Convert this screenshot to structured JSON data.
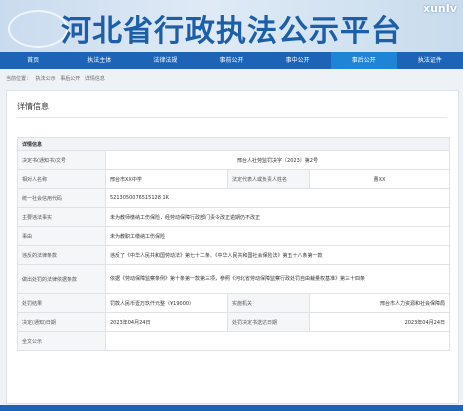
{
  "site": {
    "title": "河北省行政执法公示平台",
    "watermark": "xunIv"
  },
  "nav": [
    {
      "label": "首页"
    },
    {
      "label": "执法主体"
    },
    {
      "label": "法律法规"
    },
    {
      "label": "事前公开"
    },
    {
      "label": "事中公开"
    },
    {
      "label": "事后公开"
    },
    {
      "label": "执法证件"
    }
  ],
  "breadcrumb": [
    "当前位置：",
    "执法公示",
    "事后公开",
    "详情信息"
  ],
  "panel": {
    "title": "详情信息"
  },
  "section": {
    "label": "详情信息"
  },
  "doc_number": {
    "label": "决定书(通知书)文号",
    "value": "邢台人社劳监罚决字〔2023〕第2号"
  },
  "party": {
    "label": "相对人名称",
    "value": "邢台市XX中学",
    "legal_rep_label": "法定代表人或负责人姓名",
    "legal_rep_value": "曹XX"
  },
  "credit_code": {
    "label": "统一社会信用代码",
    "value": "5213050076515128 1K"
  },
  "violation_facts": {
    "label": "主要违法事实",
    "value": "未为教师缴纳工伤保险，经劳动保障行政部门责令改正逾期仍不改正"
  },
  "matter": {
    "label": "事由",
    "value": "未为教职工缴纳工伤保险"
  },
  "legal_basis": {
    "label": "违反的法律条款",
    "value": "违反了《中华人民共和国劳动法》第七十二条、《中华人民共和国社会保险法》第五十八条第一款"
  },
  "penalty_basis": {
    "label": "做出处罚的法律依据条款",
    "value": "依据《劳动保障监察条例》第十条第一款第三项，参照《河北省劳动保障监察行政处罚自由裁量权基准》第三十四条"
  },
  "penalty_result": {
    "label": "处罚结果",
    "value": "罚款人民币壹万玖仟元整（¥19000）",
    "org_label": "实施机关",
    "org_value": "邢台市人力资源和社会保障局"
  },
  "decision_date": {
    "label": "决定(通知)日期",
    "value": "2023年04月24日",
    "delivery_label": "处罚决定书送达日期",
    "delivery_value": "2023年04月24日"
  },
  "full_text": {
    "label": "全文公示",
    "value": ""
  }
}
